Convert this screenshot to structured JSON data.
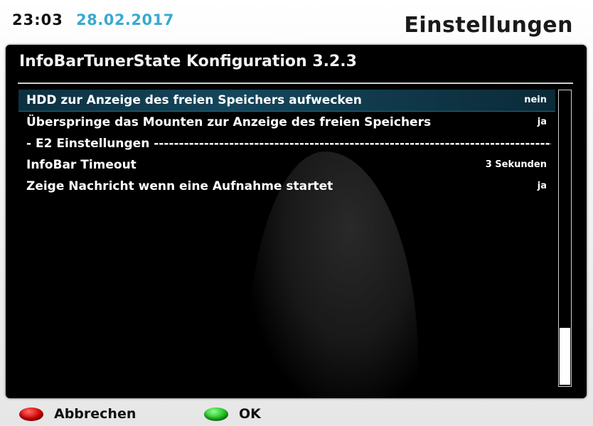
{
  "header": {
    "time": "23:03",
    "date": "28.02.2017",
    "screen_title": "Einstellungen"
  },
  "panel": {
    "title": "InfoBarTunerState Konfiguration 3.2.3",
    "rows": [
      {
        "label": "HDD zur Anzeige des freien Speichers aufwecken",
        "value": "nein",
        "selected": true
      },
      {
        "label": "Überspringe das Mounten zur Anzeige des freien Speichers",
        "value": "ja"
      },
      {
        "label": "- E2 Einstellungen ---------------------------------------------------------------------------------------------------------------------------------------------------------",
        "value": ""
      },
      {
        "label": "InfoBar Timeout",
        "value": "3 Sekunden"
      },
      {
        "label": "Zeige Nachricht wenn eine Aufnahme startet",
        "value": "ja"
      }
    ]
  },
  "footer": {
    "red_label": "Abbrechen",
    "green_label": "OK"
  },
  "colors": {
    "date": "#3aa9cf",
    "selection": "#15475c",
    "red_button": "#d40000",
    "green_button": "#1fbf1f"
  }
}
